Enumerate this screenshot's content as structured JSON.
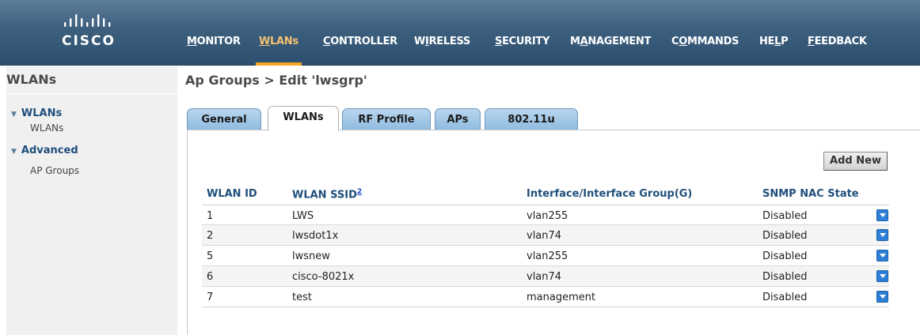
{
  "header": {
    "brand": "CISCO",
    "nav": [
      {
        "label": "MONITOR",
        "key": "M",
        "rest": "ONITOR"
      },
      {
        "label": "WLANs",
        "key": "W",
        "rest": "LANs"
      },
      {
        "label": "CONTROLLER",
        "key": "C",
        "rest": "ONTROLLER"
      },
      {
        "label": "WIRELESS",
        "pre": "W",
        "key": "I",
        "rest": "RELESS"
      },
      {
        "label": "SECURITY",
        "key": "S",
        "rest": "ECURITY"
      },
      {
        "label": "MANAGEMENT",
        "pre": "M",
        "key": "A",
        "rest": "NAGEMENT"
      },
      {
        "label": "COMMANDS",
        "pre": "C",
        "key": "O",
        "rest": "MMANDS"
      },
      {
        "label": "HELP",
        "pre": "HE",
        "key": "L",
        "rest": "P"
      },
      {
        "label": "FEEDBACK",
        "key": "F",
        "rest": "EEDBACK"
      }
    ],
    "active_nav": "WLANs"
  },
  "sidebar": {
    "title": "WLANs",
    "sections": [
      {
        "label": "WLANs",
        "links": [
          "WLANs"
        ]
      },
      {
        "label": "Advanced",
        "links": [
          "AP Groups"
        ]
      }
    ]
  },
  "main": {
    "breadcrumb": "Ap Groups > Edit  'lwsgrp'",
    "tabs": [
      "General",
      "WLANs",
      "RF Profile",
      "APs",
      "802.11u"
    ],
    "active_tab": "WLANs",
    "add_button": "Add New",
    "table": {
      "headers": [
        "WLAN ID",
        "WLAN SSID",
        "Interface/Interface Group(G)",
        "SNMP NAC State"
      ],
      "ssid_footnote": "2",
      "rows": [
        {
          "id": "1",
          "ssid": "LWS",
          "interface": "vlan255",
          "nac": "Disabled"
        },
        {
          "id": "2",
          "ssid": "lwsdot1x",
          "interface": "vlan74",
          "nac": "Disabled"
        },
        {
          "id": "5",
          "ssid": "lwsnew",
          "interface": "vlan255",
          "nac": "Disabled"
        },
        {
          "id": "6",
          "ssid": "cisco-8021x",
          "interface": "vlan74",
          "nac": "Disabled"
        },
        {
          "id": "7",
          "ssid": "test",
          "interface": "management",
          "nac": "Disabled"
        }
      ]
    }
  },
  "colors": {
    "header_top": "#5c7c97",
    "header_bottom": "#2e5070",
    "active_nav": "#f4c270",
    "tab_blue": "#8fbbe0",
    "link_blue": "#1f4f7c",
    "dropdown_blue": "#2b7fd6"
  }
}
